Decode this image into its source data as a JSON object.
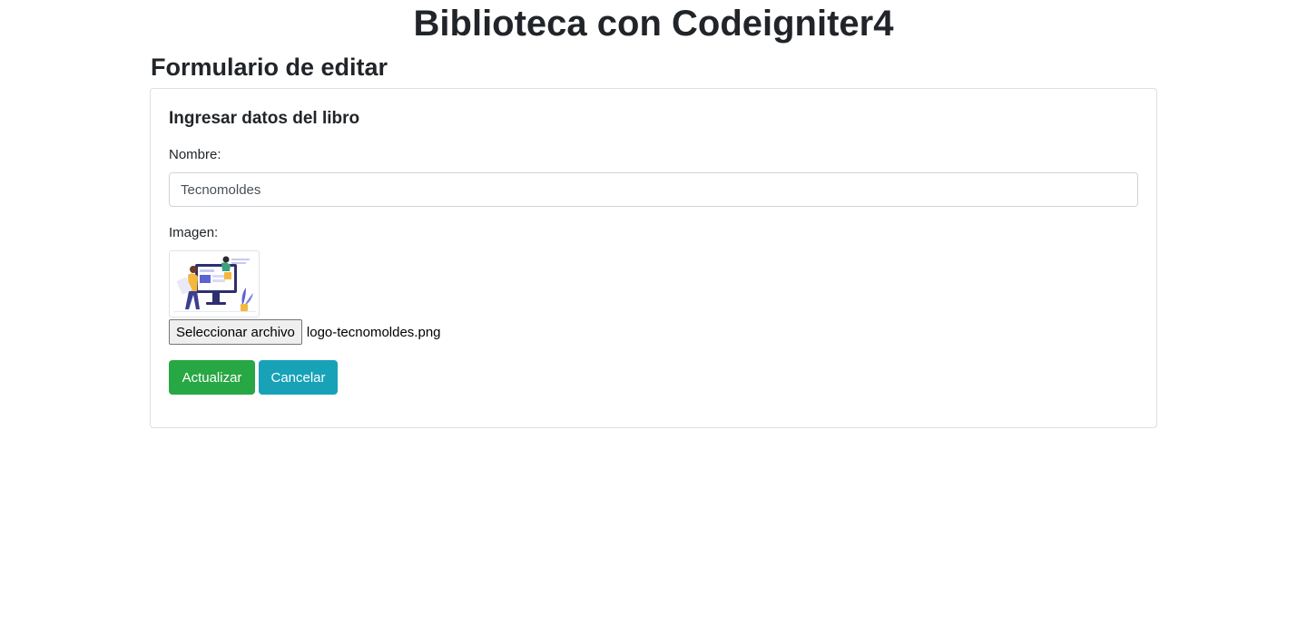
{
  "header": {
    "title": "Biblioteca con Codeigniter4",
    "subtitle": "Formulario de editar"
  },
  "form": {
    "card_title": "Ingresar datos del libro",
    "nombre_label": "Nombre:",
    "nombre_value": "Tecnomoldes",
    "imagen_label": "Imagen:",
    "thumbnail_icon": "illustration-thumbnail",
    "file_button_label": "Seleccionar archivo",
    "file_name": "logo-tecnomoldes.png",
    "update_label": "Actualizar",
    "cancel_label": "Cancelar"
  },
  "colors": {
    "success": "#28a745",
    "info": "#17a2b8",
    "text": "#212529"
  }
}
